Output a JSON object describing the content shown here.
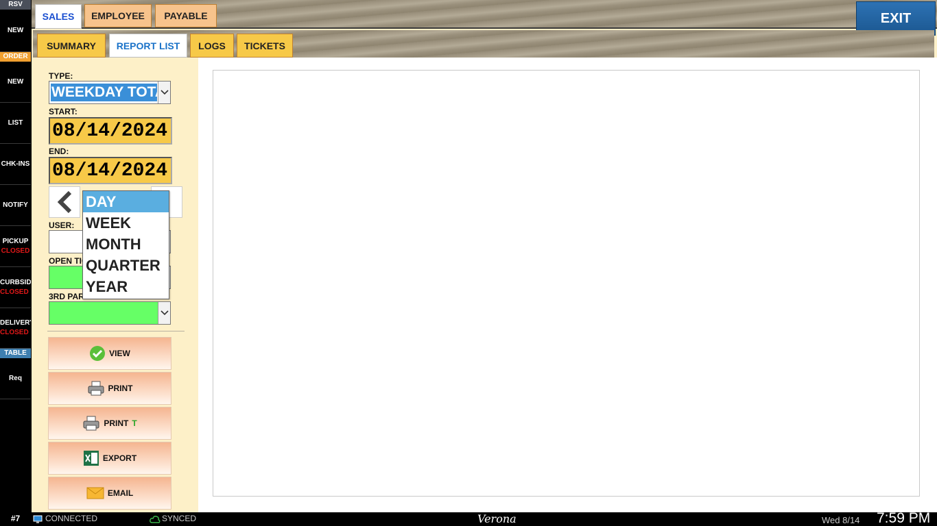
{
  "sidebar": {
    "rsv_header": "RSV",
    "rsv_new": "NEW",
    "order_header": "ORDER",
    "order_new": "NEW",
    "list": "LIST",
    "checkins": "CHK-INS",
    "notify": "NOTIFY",
    "pickup": {
      "label": "PICKUP",
      "status": "CLOSED"
    },
    "curbside": {
      "label": "CURBSID",
      "status": "CLOSED"
    },
    "delivery": {
      "label": "DELIVERY",
      "status": "CLOSED"
    },
    "table_header": "TABLE",
    "req": "Req"
  },
  "top_tabs": {
    "sales": "SALES",
    "employee": "EMPLOYEE",
    "payable": "PAYABLE"
  },
  "exit_label": "EXIT",
  "sub_tabs": {
    "summary": "SUMMARY",
    "report_list": "REPORT LIST",
    "logs": "LOGS",
    "tickets": "TICKETS"
  },
  "form": {
    "type_label": "TYPE:",
    "type_value": "WEEKDAY TOTAL",
    "start_label": "START:",
    "start_value": "08/14/2024",
    "end_label": "END:",
    "end_value": "08/14/2024",
    "user_label": "USER:",
    "open_tickets_label": "OPEN TIC",
    "third_party_label": "3RD PAR"
  },
  "period_options": [
    "DAY",
    "WEEK",
    "MONTH",
    "QUARTER",
    "YEAR"
  ],
  "actions": {
    "view": "VIEW",
    "print": "PRINT",
    "print_t": "PRINT",
    "print_t_suffix": "T",
    "export": "EXPORT",
    "email": "EMAIL"
  },
  "status_bar": {
    "station": "#7",
    "connection": "CONNECTED",
    "sync": "SYNCED",
    "location": "Verona",
    "date": "Wed 8/14",
    "time": "7:59 PM"
  },
  "colors": {
    "accent_blue": "#1b5790",
    "tab_yellow": "#f7c948",
    "green_field": "#66ff66",
    "closed_red": "#e01818"
  }
}
